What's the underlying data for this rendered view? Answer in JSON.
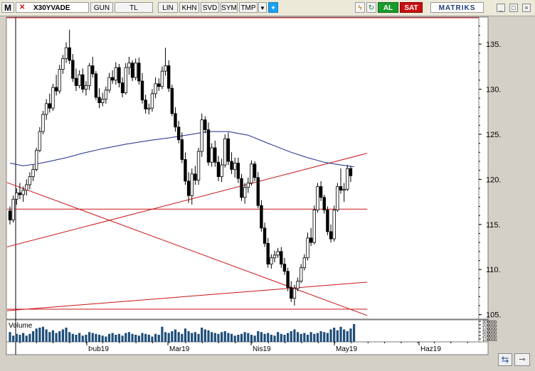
{
  "toolbar": {
    "menu_label": "M",
    "symbol": "X30YVADE",
    "period": "GUN",
    "currency": "TL",
    "scale": "LIN",
    "khn": "KHN",
    "svd": "SVD",
    "sym": "SYM",
    "tmp": "TMP",
    "buy": "AL",
    "sell": "SAT",
    "brand": "MATRIKS"
  },
  "chart_data": {
    "type": "candlestick",
    "y_ticks": [
      "135.",
      "130.",
      "125.",
      "120.",
      "115.",
      "110.",
      "105."
    ],
    "ylim": [
      104.5,
      138
    ],
    "x_ticks": [
      "Þub19",
      "Mar19",
      "Nis19",
      "May19",
      "Haz19"
    ],
    "volume_label": "Volume",
    "volume_ticks": [
      "300000.",
      "200000.",
      "100000.",
      "300000.",
      "200000.",
      "100000."
    ],
    "colors": {
      "up": "#ffffff",
      "down": "#000000",
      "ma": "#1c2a8c",
      "lines": "#c81414",
      "volume": "#1f4e79"
    },
    "ohlc": [
      [
        116.5,
        117.0,
        115.0,
        115.5
      ],
      [
        115.5,
        118.2,
        115.2,
        117.8
      ],
      [
        117.8,
        119.0,
        117.2,
        118.5
      ],
      [
        118.5,
        119.6,
        117.8,
        118.3
      ],
      [
        118.3,
        119.2,
        117.5,
        118.8
      ],
      [
        118.8,
        120.0,
        118.2,
        119.4
      ],
      [
        119.4,
        120.8,
        118.9,
        120.3
      ],
      [
        120.3,
        121.6,
        119.8,
        121.1
      ],
      [
        121.1,
        123.5,
        120.9,
        123.2
      ],
      [
        123.2,
        125.8,
        123.0,
        125.3
      ],
      [
        125.3,
        127.6,
        125.0,
        127.2
      ],
      [
        127.2,
        128.9,
        126.6,
        128.4
      ],
      [
        128.4,
        129.5,
        127.4,
        127.9
      ],
      [
        127.9,
        130.6,
        127.6,
        130.2
      ],
      [
        130.2,
        131.6,
        129.3,
        129.8
      ],
      [
        129.8,
        132.7,
        129.5,
        132.2
      ],
      [
        132.2,
        133.8,
        131.7,
        133.4
      ],
      [
        133.4,
        135.2,
        132.9,
        134.6
      ],
      [
        134.6,
        136.6,
        132.8,
        133.2
      ],
      [
        133.2,
        133.9,
        130.8,
        131.2
      ],
      [
        131.2,
        132.3,
        129.8,
        130.4
      ],
      [
        130.4,
        132.1,
        130.1,
        131.6
      ],
      [
        131.6,
        132.3,
        129.6,
        130.0
      ],
      [
        130.0,
        130.9,
        129.3,
        130.4
      ],
      [
        130.4,
        132.9,
        129.9,
        132.6
      ],
      [
        132.6,
        133.6,
        131.3,
        131.7
      ],
      [
        131.7,
        132.0,
        128.8,
        129.1
      ],
      [
        129.1,
        130.1,
        127.9,
        128.5
      ],
      [
        128.5,
        129.6,
        128.1,
        128.9
      ],
      [
        128.9,
        130.3,
        128.4,
        129.9
      ],
      [
        129.9,
        131.8,
        129.6,
        131.3
      ],
      [
        131.3,
        132.1,
        130.6,
        131.0
      ],
      [
        131.0,
        133.0,
        130.5,
        132.4
      ],
      [
        132.4,
        132.8,
        130.2,
        130.7
      ],
      [
        130.7,
        131.3,
        129.1,
        129.6
      ],
      [
        129.6,
        132.9,
        129.4,
        132.4
      ],
      [
        132.4,
        133.6,
        131.6,
        132.9
      ],
      [
        132.9,
        133.2,
        130.9,
        131.3
      ],
      [
        131.3,
        133.4,
        131.0,
        132.9
      ],
      [
        132.9,
        133.5,
        130.5,
        130.9
      ],
      [
        130.9,
        131.8,
        128.4,
        128.8
      ],
      [
        128.8,
        129.4,
        127.3,
        127.8
      ],
      [
        127.8,
        128.4,
        127.2,
        127.9
      ],
      [
        127.9,
        130.0,
        127.5,
        129.5
      ],
      [
        129.5,
        131.3,
        129.0,
        130.6
      ],
      [
        130.6,
        131.2,
        129.8,
        130.3
      ],
      [
        130.3,
        132.5,
        130.0,
        132.0
      ],
      [
        132.0,
        134.6,
        131.5,
        132.6
      ],
      [
        132.6,
        133.2,
        129.7,
        130.1
      ],
      [
        130.1,
        130.5,
        127.0,
        127.3
      ],
      [
        127.3,
        128.0,
        125.3,
        125.8
      ],
      [
        125.8,
        126.5,
        124.0,
        124.4
      ],
      [
        124.4,
        125.2,
        121.8,
        122.2
      ],
      [
        122.2,
        123.0,
        119.4,
        119.8
      ],
      [
        119.8,
        120.8,
        117.4,
        118.2
      ],
      [
        118.2,
        121.2,
        117.2,
        120.6
      ],
      [
        120.6,
        121.5,
        119.4,
        119.9
      ],
      [
        119.9,
        123.5,
        119.4,
        123.1
      ],
      [
        123.1,
        127.3,
        122.5,
        126.6
      ],
      [
        126.6,
        127.0,
        125.1,
        125.5
      ],
      [
        125.5,
        126.3,
        121.5,
        121.9
      ],
      [
        121.9,
        124.0,
        121.4,
        123.5
      ],
      [
        123.5,
        124.3,
        121.4,
        121.9
      ],
      [
        121.9,
        122.6,
        119.8,
        120.3
      ],
      [
        120.3,
        122.3,
        119.7,
        121.6
      ],
      [
        121.6,
        125.0,
        121.3,
        124.5
      ],
      [
        124.5,
        125.2,
        121.6,
        122.0
      ],
      [
        122.0,
        123.0,
        120.6,
        121.1
      ],
      [
        121.1,
        122.4,
        120.2,
        121.8
      ],
      [
        121.8,
        122.4,
        119.6,
        120.1
      ],
      [
        120.1,
        120.6,
        117.6,
        118.0
      ],
      [
        118.0,
        119.6,
        117.3,
        119.1
      ],
      [
        119.1,
        120.2,
        118.5,
        119.6
      ],
      [
        119.6,
        122.1,
        119.3,
        121.7
      ],
      [
        121.7,
        122.0,
        119.8,
        120.2
      ],
      [
        120.2,
        120.8,
        116.8,
        117.1
      ],
      [
        117.1,
        117.7,
        114.2,
        114.6
      ],
      [
        114.6,
        115.2,
        112.5,
        112.9
      ],
      [
        112.9,
        113.5,
        110.2,
        110.6
      ],
      [
        110.6,
        111.7,
        110.1,
        111.3
      ],
      [
        111.3,
        112.1,
        110.8,
        111.6
      ],
      [
        111.6,
        112.4,
        111.3,
        112.0
      ],
      [
        112.0,
        112.5,
        110.2,
        110.6
      ],
      [
        110.6,
        111.3,
        109.4,
        109.8
      ],
      [
        109.8,
        110.2,
        107.6,
        108.0
      ],
      [
        108.0,
        108.7,
        106.4,
        106.8
      ],
      [
        106.8,
        108.3,
        106.0,
        107.9
      ],
      [
        107.9,
        109.1,
        107.6,
        108.7
      ],
      [
        108.7,
        110.6,
        108.5,
        110.2
      ],
      [
        110.2,
        111.7,
        109.9,
        111.3
      ],
      [
        111.3,
        114.1,
        111.0,
        113.5
      ],
      [
        113.5,
        114.6,
        112.6,
        113.0
      ],
      [
        113.0,
        117.1,
        112.8,
        116.6
      ],
      [
        116.6,
        119.6,
        116.3,
        119.2
      ],
      [
        119.2,
        119.8,
        117.6,
        118.0
      ],
      [
        118.0,
        118.3,
        116.2,
        116.6
      ],
      [
        116.6,
        117.0,
        113.8,
        114.2
      ],
      [
        114.2,
        115.0,
        113.0,
        113.4
      ],
      [
        113.4,
        117.1,
        113.1,
        116.6
      ],
      [
        116.6,
        119.6,
        116.4,
        119.2
      ],
      [
        119.2,
        121.2,
        118.4,
        118.8
      ],
      [
        118.8,
        119.6,
        117.5,
        118.9
      ],
      [
        118.9,
        121.6,
        118.7,
        121.2
      ],
      [
        121.2,
        121.5,
        119.7,
        120.4
      ]
    ],
    "ma": [
      [
        0,
        121.8
      ],
      [
        4,
        121.5
      ],
      [
        8,
        121.7
      ],
      [
        12,
        122.0
      ],
      [
        17,
        122.4
      ],
      [
        22,
        122.9
      ],
      [
        28,
        123.4
      ],
      [
        35,
        123.9
      ],
      [
        42,
        124.3
      ],
      [
        48,
        124.6
      ],
      [
        55,
        125.0
      ],
      [
        60,
        125.3
      ],
      [
        66,
        125.3
      ],
      [
        72,
        124.9
      ],
      [
        78,
        124.0
      ],
      [
        85,
        123.0
      ],
      [
        90,
        122.4
      ],
      [
        95,
        121.9
      ],
      [
        100,
        121.6
      ],
      [
        104,
        121.4
      ]
    ],
    "lines": [
      {
        "from": [
          -2,
          119.8
        ],
        "to": [
          108,
          104.9
        ]
      },
      {
        "from": [
          -2,
          112.4
        ],
        "to": [
          108,
          122.9
        ]
      },
      {
        "from": [
          -2,
          116.7
        ],
        "to": [
          108,
          116.7
        ]
      },
      {
        "from": [
          -2,
          105.4
        ],
        "to": [
          108,
          108.6
        ]
      },
      {
        "from": [
          -2,
          105.6
        ],
        "to": [
          108,
          105.6
        ]
      }
    ],
    "volume": [
      0.55,
      0.35,
      0.45,
      0.4,
      0.5,
      0.35,
      0.45,
      0.6,
      0.75,
      0.8,
      0.85,
      0.7,
      0.55,
      0.65,
      0.5,
      0.6,
      0.7,
      0.8,
      0.55,
      0.45,
      0.4,
      0.5,
      0.35,
      0.4,
      0.55,
      0.5,
      0.45,
      0.4,
      0.35,
      0.3,
      0.45,
      0.5,
      0.4,
      0.45,
      0.35,
      0.5,
      0.55,
      0.45,
      0.4,
      0.35,
      0.5,
      0.45,
      0.4,
      0.3,
      0.45,
      0.4,
      0.85,
      0.55,
      0.5,
      0.6,
      0.7,
      0.55,
      0.45,
      0.75,
      0.6,
      0.5,
      0.55,
      0.45,
      0.8,
      0.7,
      0.65,
      0.55,
      0.5,
      0.45,
      0.55,
      0.6,
      0.5,
      0.45,
      0.35,
      0.4,
      0.45,
      0.55,
      0.5,
      0.4,
      0.35,
      0.6,
      0.55,
      0.45,
      0.5,
      0.4,
      0.35,
      0.55,
      0.45,
      0.4,
      0.5,
      0.6,
      0.7,
      0.55,
      0.45,
      0.5,
      0.4,
      0.55,
      0.45,
      0.5,
      0.6,
      0.55,
      0.5,
      0.7,
      0.8,
      0.65,
      0.85,
      0.7,
      0.6,
      0.75,
      1.0
    ]
  }
}
